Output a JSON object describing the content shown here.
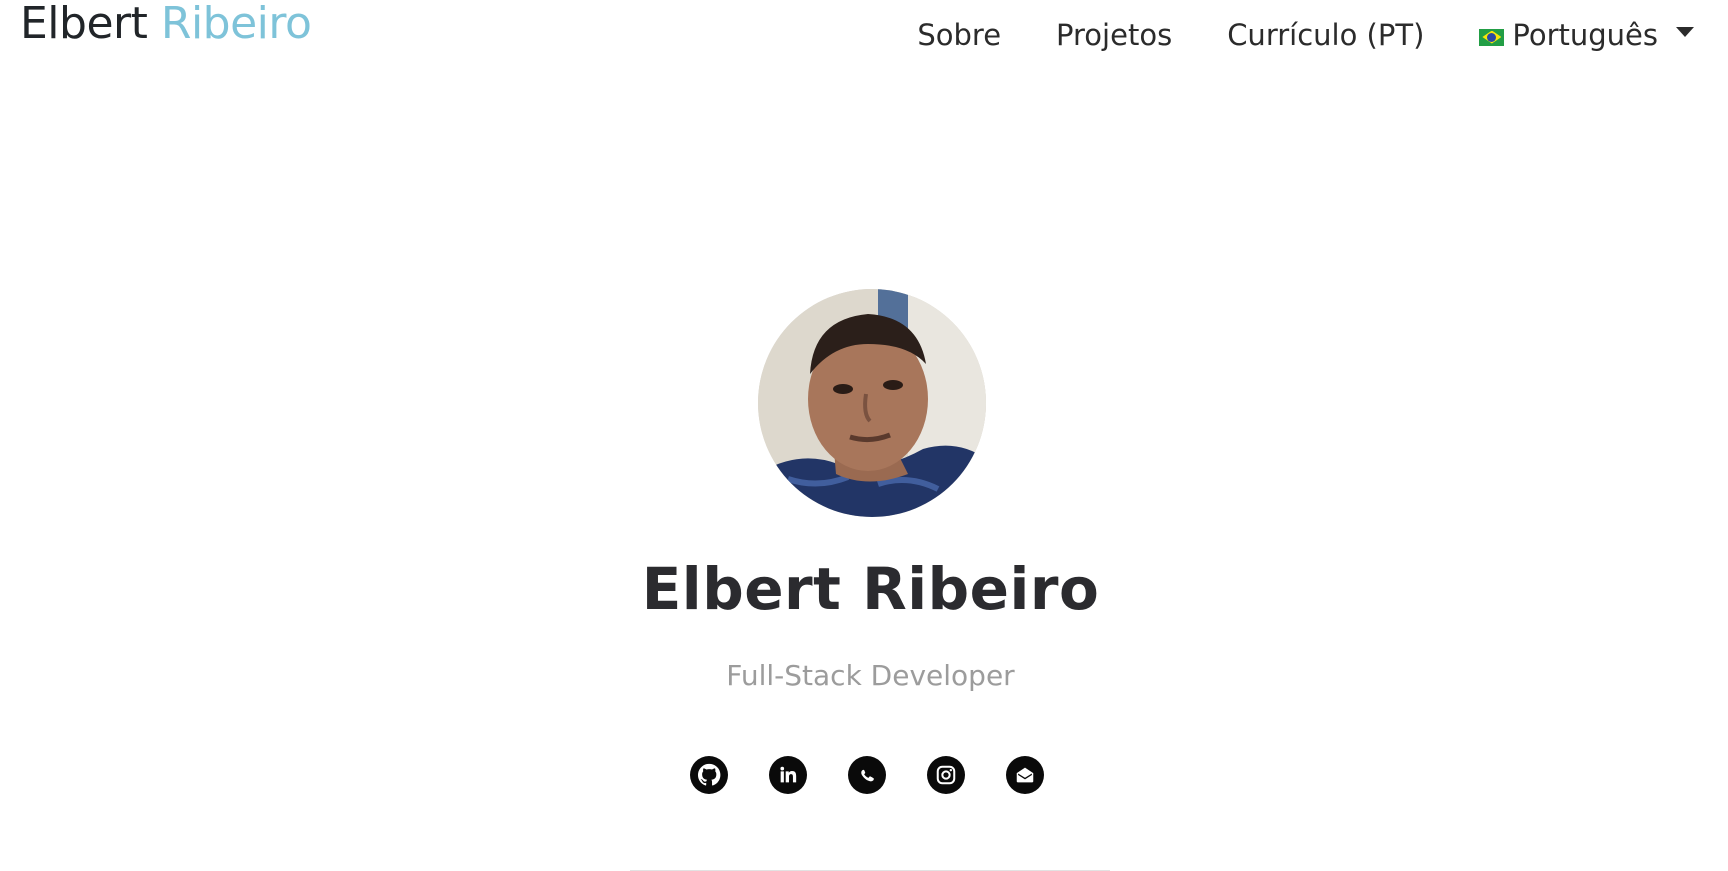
{
  "navbar": {
    "brand_first": "Elbert",
    "brand_second": "Ribeiro",
    "links": [
      {
        "label": "Sobre"
      },
      {
        "label": "Projetos"
      },
      {
        "label": "Currículo (PT)"
      }
    ],
    "language": {
      "label": "Português",
      "flag_icon": "brazil-flag-icon"
    }
  },
  "hero": {
    "name": "Elbert Ribeiro",
    "role": "Full-Stack Developer",
    "socials": [
      {
        "icon": "github-icon"
      },
      {
        "icon": "linkedin-icon"
      },
      {
        "icon": "whatsapp-icon"
      },
      {
        "icon": "instagram-icon"
      },
      {
        "icon": "email-icon"
      }
    ]
  },
  "colors": {
    "brand_accent": "#7ec3d9",
    "text": "#212529",
    "muted": "#9c9c9c",
    "icon": "#0a0a0a"
  }
}
